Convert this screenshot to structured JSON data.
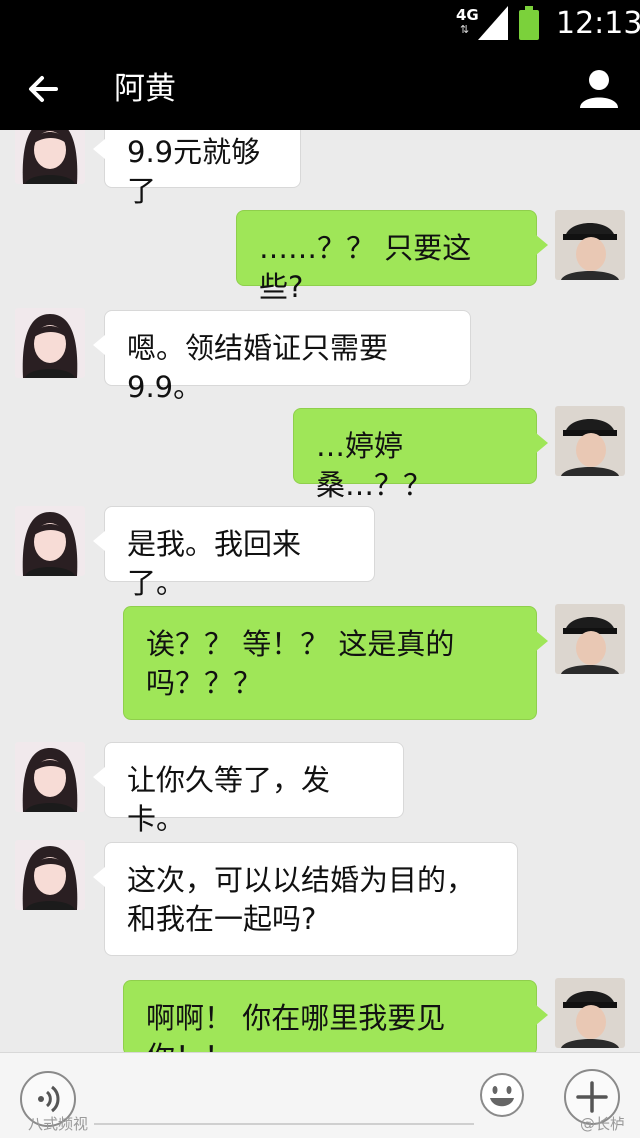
{
  "status_bar": {
    "network": "4G",
    "time": "12:13"
  },
  "header": {
    "title": "阿黄"
  },
  "messages": [
    {
      "side": "left",
      "text": "9.9元就够了"
    },
    {
      "side": "right",
      "text": "……？？ 只要这些?"
    },
    {
      "side": "left",
      "text": "嗯。领结婚证只需要9.9。"
    },
    {
      "side": "right",
      "text": "…婷婷桑…？？"
    },
    {
      "side": "left",
      "text": "是我。我回来了。"
    },
    {
      "side": "right",
      "text": "诶？？ 等！？ 这是真的吗？？？"
    },
    {
      "side": "left",
      "text": "让你久等了，发卡。"
    },
    {
      "side": "left",
      "text": "这次，可以以结婚为目的，和我在一起吗?"
    },
    {
      "side": "right",
      "text": "啊啊！ 你在哪里我要见你！！"
    }
  ],
  "watermarks": {
    "left": "八式频视",
    "right": "@长栌"
  },
  "colors": {
    "sent_bubble": "#9fe658",
    "received_bubble": "#ffffff",
    "header": "#000000",
    "chat_bg": "#ebebeb"
  },
  "icons": [
    "back-arrow-icon",
    "profile-icon",
    "voice-icon",
    "emoji-icon",
    "plus-icon"
  ]
}
